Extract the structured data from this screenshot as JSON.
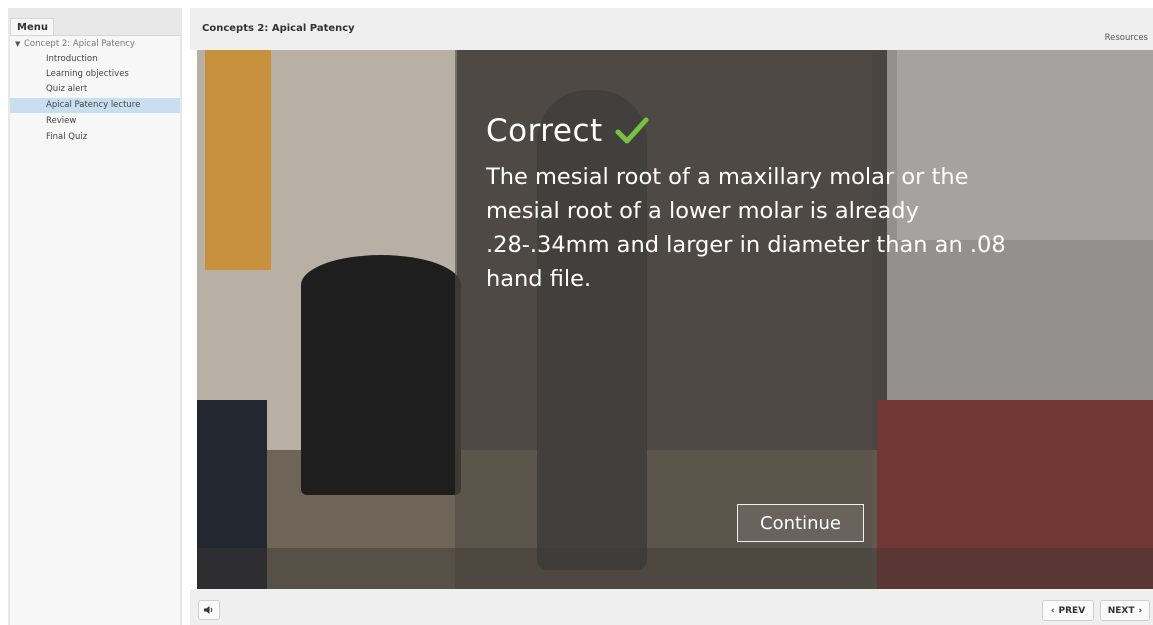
{
  "sidebar": {
    "menu_label": "Menu",
    "items": [
      {
        "label": "Concept 2: Apical Patency",
        "level": "parent"
      },
      {
        "label": "Introduction",
        "level": "child"
      },
      {
        "label": "Learning objectives",
        "level": "child"
      },
      {
        "label": "Quiz alert",
        "level": "child"
      },
      {
        "label": "Apical Patency lecture",
        "level": "child",
        "active": true
      },
      {
        "label": "Review",
        "level": "child"
      },
      {
        "label": "Final Quiz",
        "level": "child"
      }
    ]
  },
  "header": {
    "title": "Concepts 2: Apical Patency",
    "resources_label": "Resources"
  },
  "feedback": {
    "title": "Correct",
    "message": "The mesial root of a maxillary molar or the mesial root of a lower molar is already .28-.34mm and larger in diameter than an .08 hand file.",
    "continue_label": "Continue",
    "check_color": "#7ac142"
  },
  "footer": {
    "prev_label": "PREV",
    "next_label": "NEXT"
  },
  "icons": {
    "volume": "speaker-icon",
    "check": "check-icon",
    "prev": "chevron-left-icon",
    "next": "chevron-right-icon",
    "expand": "caret-down-icon"
  }
}
